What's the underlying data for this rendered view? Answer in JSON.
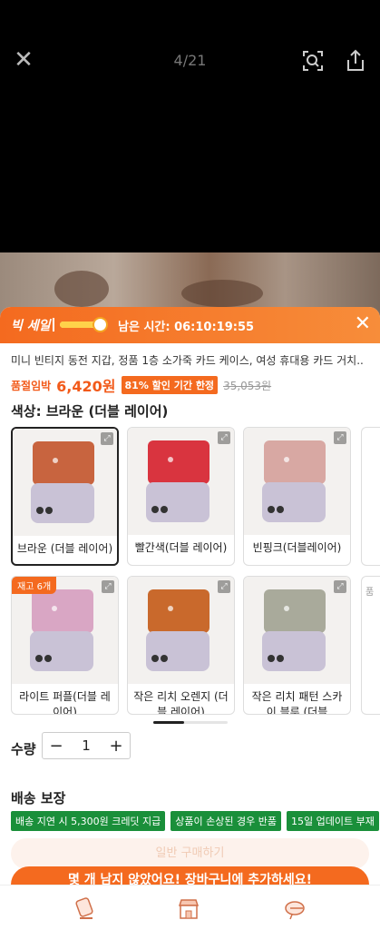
{
  "viewer": {
    "counter": "4/21"
  },
  "sale": {
    "title": "빅 세일",
    "timer": "남은 시간: 06:10:19:55",
    "progress": 0.75
  },
  "product": {
    "name": "미니 빈티지 동전 지갑, 정품 1층 소가죽 카드 케이스, 여성 휴대용 카드 거치...",
    "price_prefix": "품절임박",
    "price": "6,420원",
    "discount_badge": "81% 할인 기간 한정",
    "original_price": "35,053원"
  },
  "color_selector": {
    "label": "색상: 브라운 (더블 레이어)",
    "options": [
      {
        "label": "브라운 (더블 레이어)",
        "color": "#c8643f",
        "selected": true
      },
      {
        "label": "빨간색(더블 레이어)",
        "color": "#d9343f",
        "selected": false
      },
      {
        "label": "빈핑크(더블레이어)",
        "color": "#d8a8a3",
        "selected": false
      },
      {
        "label": "라이트 퍼플(더블 레이어)",
        "color": "#d9a6c4",
        "selected": false,
        "stock": "재고 6개"
      },
      {
        "label": "작은 리치 오렌지 (더블 레이어)",
        "color": "#c9692c",
        "selected": false
      },
      {
        "label": "작은 리치 패턴 스카이 블루 (더블",
        "color": "#a9aa9b",
        "selected": false
      }
    ],
    "partial_right_label": "품"
  },
  "quantity": {
    "label": "수량",
    "value": "1",
    "minus": "−",
    "plus": "+"
  },
  "shipping": {
    "title": "배송 보장",
    "tags": [
      "배송 지연 시 5,300원 크레딧 지급",
      "상품이 손상된 경우 반품",
      "15일 업데이트 부재"
    ]
  },
  "buttons": {
    "faded": "일반 구매하기",
    "cart": "몇 개 남지 않았어요! 장바구니에 추가하세요!"
  },
  "colors": {
    "accent": "#f46a1f",
    "ship_green": "#1a8f3a"
  }
}
